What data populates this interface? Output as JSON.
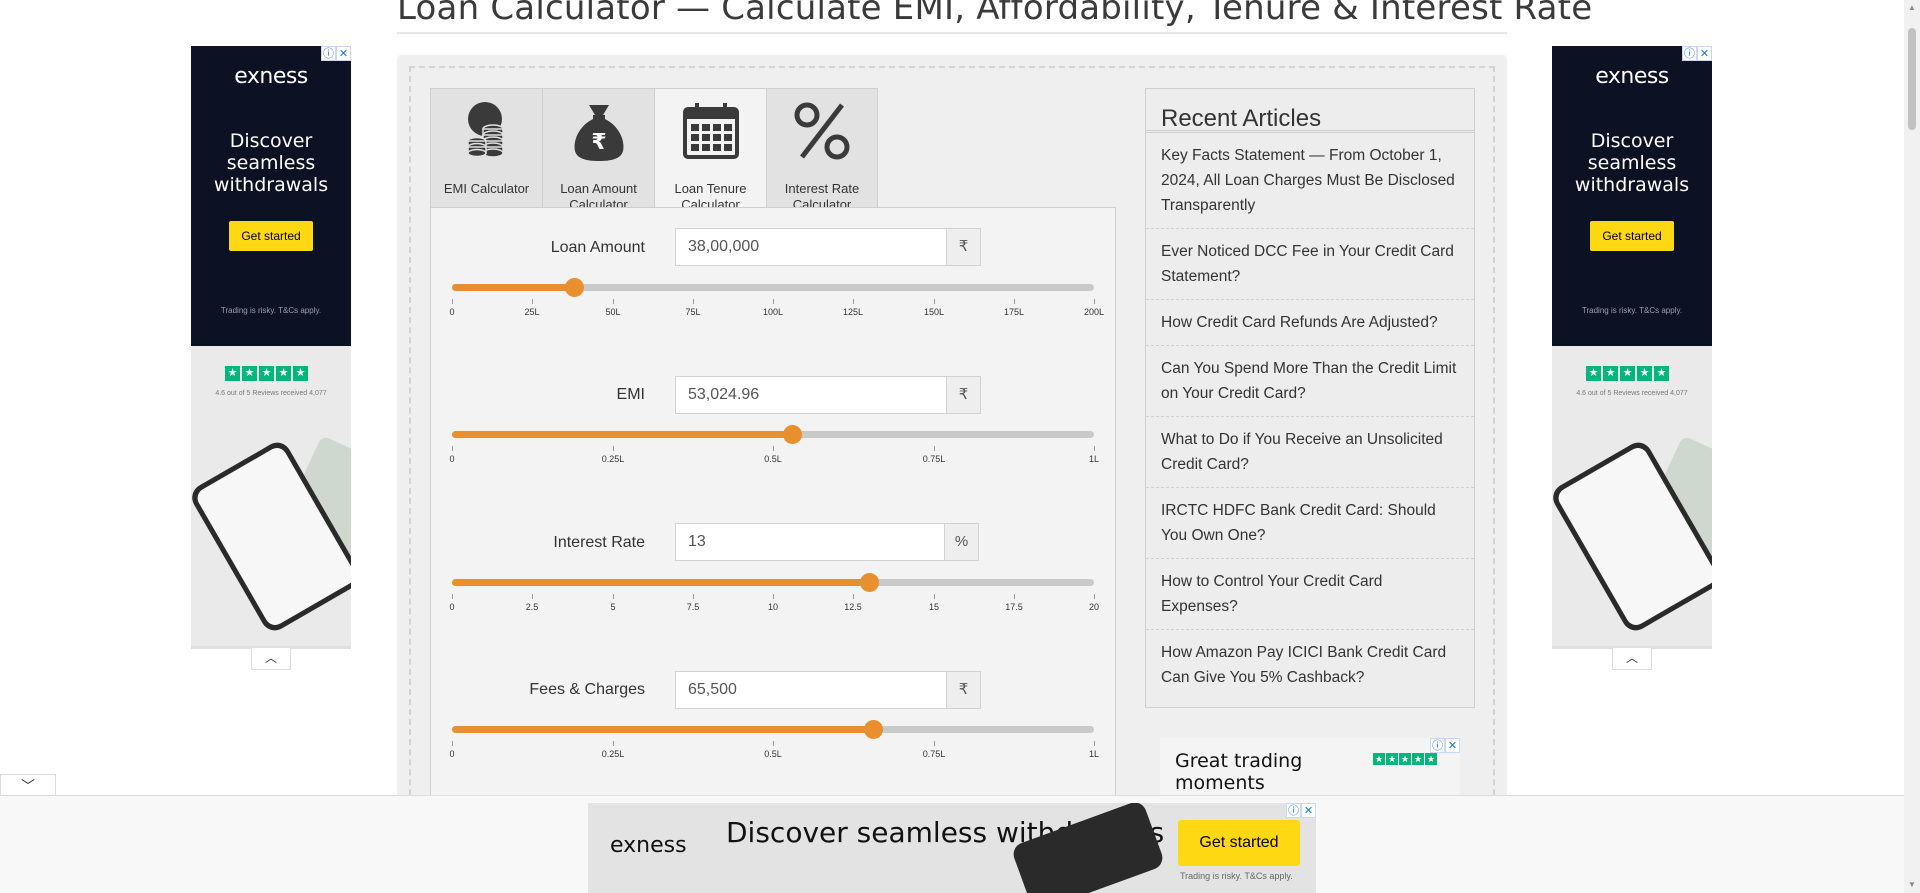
{
  "page": {
    "title": "Loan Calculator — Calculate EMI, Affordability, Tenure & Interest Rate"
  },
  "tabs": [
    {
      "label": "EMI Calculator",
      "icon": "coins-stack-icon",
      "active": false
    },
    {
      "label": "Loan Amount Calculator",
      "icon": "money-bag-icon",
      "active": false
    },
    {
      "label": "Loan Tenure Calculator",
      "icon": "calendar-icon",
      "active": true
    },
    {
      "label": "Interest Rate Calculator",
      "icon": "percent-icon",
      "active": false
    }
  ],
  "fields": {
    "loan_amount": {
      "label": "Loan Amount",
      "value": "38,00,000",
      "unit": "₹",
      "fraction": 0.19,
      "ticks": [
        "0",
        "25L",
        "50L",
        "75L",
        "100L",
        "125L",
        "150L",
        "175L",
        "200L"
      ]
    },
    "emi": {
      "label": "EMI",
      "value": "53,024.96",
      "unit": "₹",
      "fraction": 0.53,
      "ticks": [
        "0",
        "0.25L",
        "0.5L",
        "0.75L",
        "1L"
      ]
    },
    "interest_rate": {
      "label": "Interest Rate",
      "value": "13",
      "unit": "%",
      "fraction": 0.65,
      "ticks": [
        "0",
        "2.5",
        "5",
        "7.5",
        "10",
        "12.5",
        "15",
        "17.5",
        "20"
      ]
    },
    "fees": {
      "label": "Fees & Charges",
      "value": "65,500",
      "unit": "₹",
      "fraction": 0.655,
      "ticks": [
        "0",
        "0.25L",
        "0.5L",
        "0.75L",
        "1L"
      ]
    }
  },
  "articles": {
    "heading": "Recent Articles",
    "items": [
      "Key Facts Statement — From October 1, 2024, All Loan Charges Must Be Disclosed Transparently",
      "Ever Noticed DCC Fee in Your Credit Card Statement?",
      "How Credit Card Refunds Are Adjusted?",
      "Can You Spend More Than the Credit Limit on Your Credit Card?",
      "What to Do if You Receive an Unsolicited Credit Card?",
      "IRCTC HDFC Bank Credit Card: Should You Own One?",
      "How to Control Your Credit Card Expenses?",
      "How Amazon Pay ICICI Bank Credit Card Can Give You 5% Cashback?"
    ]
  },
  "side_ad": {
    "brand": "exness",
    "headline": "Discover seamless withdrawals",
    "cta": "Get started",
    "risk": "Trading is risky. T&Cs apply.",
    "reviews": "4.6 out of 5 Reviews received 4,077"
  },
  "mid_ad": {
    "headline": "Great trading moments"
  },
  "bottom_ad": {
    "brand": "exness",
    "headline": "Discover seamless withdrawals",
    "cta": "Get started",
    "risk": "Trading is risky. T&Cs apply."
  },
  "colors": {
    "accent": "#ea8f2d",
    "ad_dark": "#0c1123",
    "cta_yellow": "#ffd814",
    "trustpilot": "#00b67a"
  }
}
